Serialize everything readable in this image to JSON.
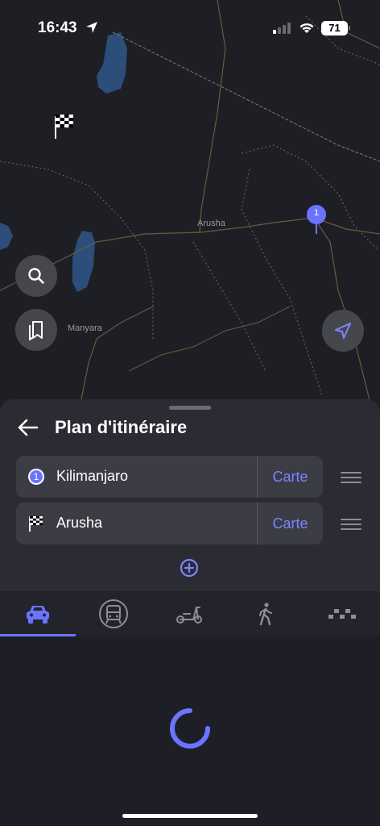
{
  "status_bar": {
    "time": "16:43",
    "battery": "71"
  },
  "map": {
    "labels": {
      "arusha": "Arusha",
      "manyara": "Manyara"
    },
    "marker_number": "1"
  },
  "sheet": {
    "title": "Plan d'itinéraire",
    "stops": [
      {
        "number": "1",
        "label": "Kilimanjaro",
        "map_button": "Carte"
      },
      {
        "label": "Arusha",
        "map_button": "Carte"
      }
    ]
  },
  "transport_modes": [
    {
      "name": "car",
      "active": true
    },
    {
      "name": "public-transport",
      "active": false
    },
    {
      "name": "scooter",
      "active": false
    },
    {
      "name": "walk",
      "active": false
    },
    {
      "name": "taxi",
      "active": false
    }
  ],
  "colors": {
    "accent": "#6b74ff",
    "accent_text": "#7c86ff",
    "sheet_bg": "#2a2b33"
  }
}
